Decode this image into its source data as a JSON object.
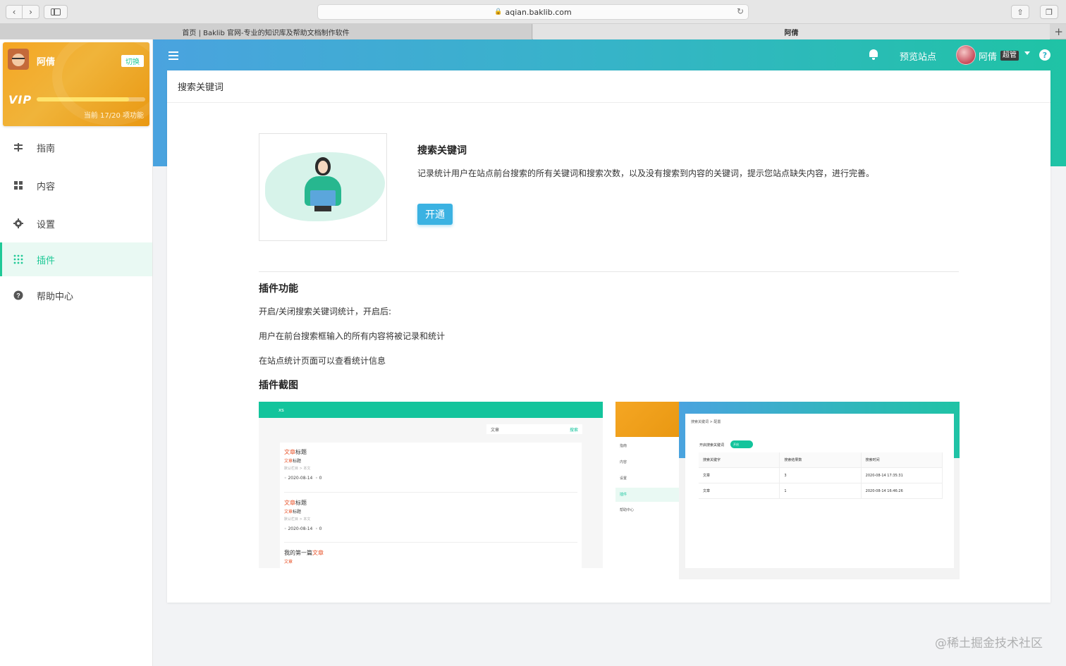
{
  "browser": {
    "url": "aqian.baklib.com",
    "tabs": [
      {
        "label": "首页 | Baklib 官网-专业的知识库及帮助文档制作软件"
      },
      {
        "label": "阿倩"
      }
    ]
  },
  "sidebar": {
    "vip": {
      "name": "阿倩",
      "switch_label": "切换",
      "logo": "VIP",
      "usage_text": "当前 17/20 项功能",
      "usage_fraction": 0.85
    },
    "items": [
      {
        "label": "指南",
        "icon": "guide-icon"
      },
      {
        "label": "内容",
        "icon": "grid-icon"
      },
      {
        "label": "设置",
        "icon": "gear-icon"
      },
      {
        "label": "插件",
        "icon": "dots-grid-icon",
        "active": true
      },
      {
        "label": "帮助中心",
        "icon": "help-icon"
      }
    ]
  },
  "header": {
    "preview_label": "预览站点",
    "user_name": "阿倩",
    "role_badge": "超管"
  },
  "panel": {
    "title": "搜索关键词",
    "plugin_name": "搜索关键词",
    "plugin_desc": "记录统计用户在站点前台搜索的所有关键词和搜索次数，以及没有搜索到内容的关键词，提示您站点缺失内容，进行完善。",
    "open_label": "开通",
    "features_title": "插件功能",
    "features": [
      "开启/关闭搜索关键词统计，开启后:",
      "用户在前台搜索框输入的所有内容将被记录和统计",
      "在站点统计页面可以查看统计信息"
    ],
    "screens_title": "插件截图"
  },
  "screenshot1": {
    "site": "xs",
    "search_value": "文章",
    "search_btn": "搜索",
    "articles": [
      {
        "title_pre": "",
        "title_hl": "文章",
        "title_post": "标题",
        "sub_hl": "文章",
        "sub": "标题",
        "meta": "默认栏目 > 本文",
        "date": "2020-08-14",
        "count": "0"
      },
      {
        "title_pre": "",
        "title_hl": "文章",
        "title_post": "标题",
        "sub_hl": "文章",
        "sub": "标题",
        "meta": "默认栏目 > 本文",
        "date": "2020-08-14",
        "count": "0"
      },
      {
        "title_pre": "我的第一篇",
        "title_hl": "文章",
        "title_post": "",
        "sub_hl": "文章",
        "sub": "",
        "meta": "",
        "date": "",
        "count": ""
      }
    ]
  },
  "screenshot2": {
    "crumb": "搜索关键词 > 配置",
    "toggle_label": "开启搜索关键词",
    "toggle_text": "开启",
    "menu": [
      "指南",
      "内容",
      "设置",
      "插件",
      "帮助中心"
    ],
    "table_headers": [
      "搜索关键字",
      "搜索结果数",
      "搜索时间"
    ],
    "rows": [
      [
        "文章",
        "3",
        "2020-08-14 17:35:31"
      ],
      [
        "文章",
        "1",
        "2020-08-14 16:46:26"
      ]
    ]
  },
  "watermark": "@稀土掘金技术社区",
  "colors": {
    "accent": "#20c997",
    "button": "#3bb2e2",
    "vip": "#f5a623"
  }
}
